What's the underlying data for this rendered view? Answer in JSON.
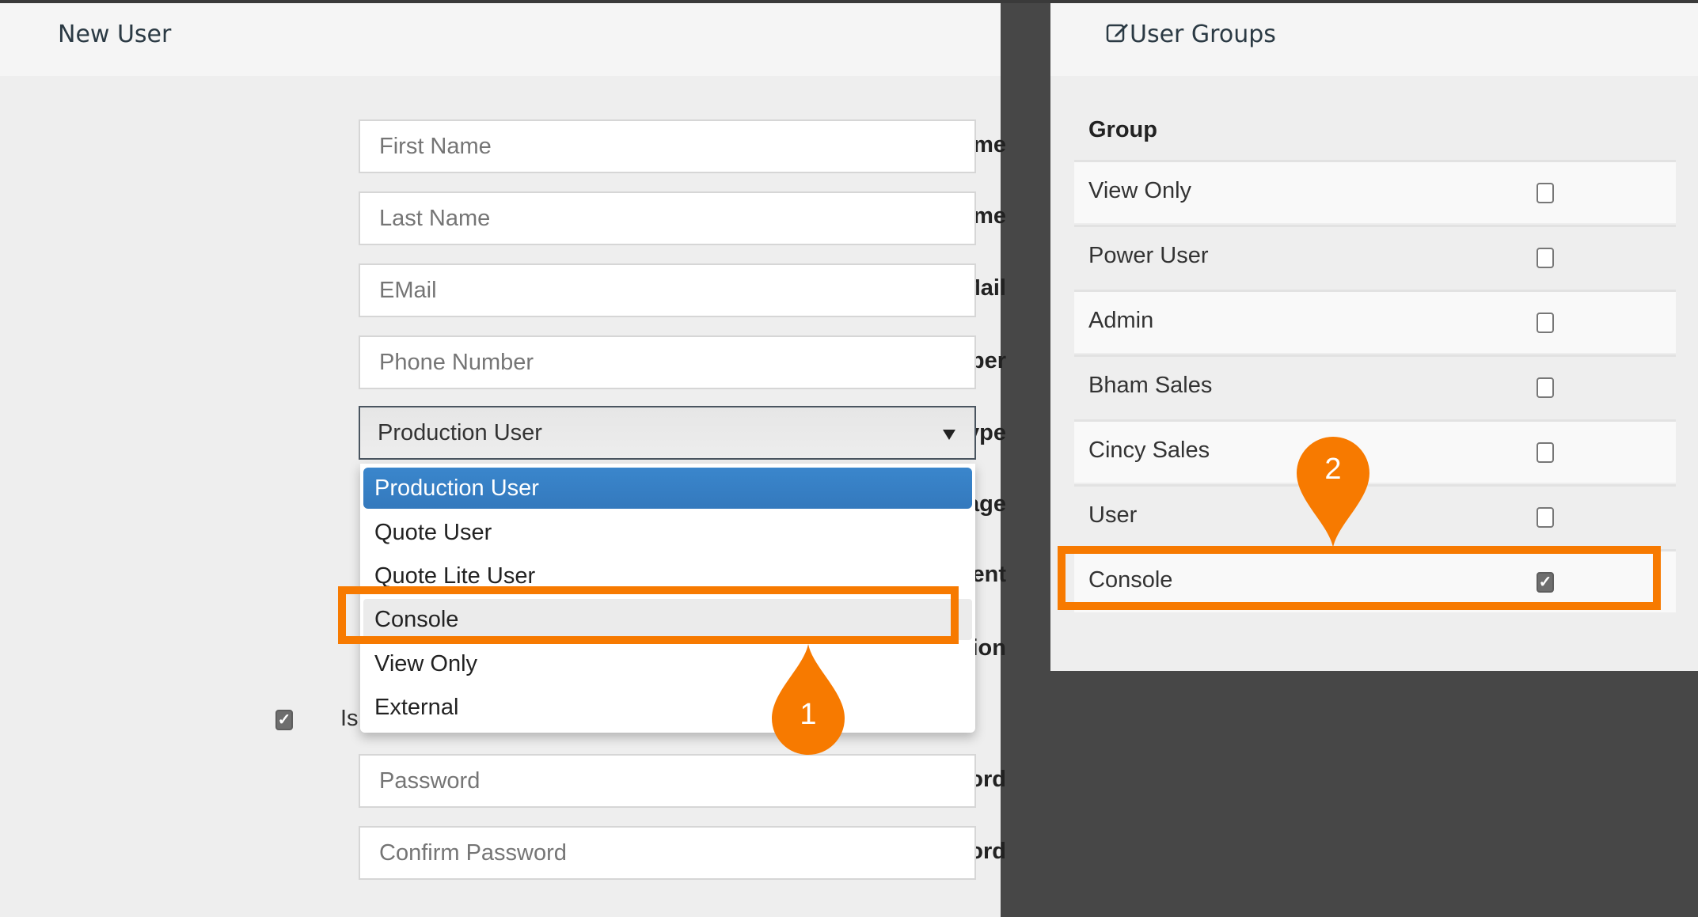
{
  "new_user_panel": {
    "title": "New User",
    "fields": [
      {
        "label": "First Name",
        "placeholder": "First Name"
      },
      {
        "label": "Last Name",
        "placeholder": "Last Name"
      },
      {
        "label": "E-Mail",
        "placeholder": "EMail"
      },
      {
        "label": "Phone Number",
        "placeholder": "Phone Number"
      },
      {
        "label": "Password",
        "placeholder": "Password"
      },
      {
        "label": "Confirm password",
        "placeholder": "Confirm Password"
      }
    ],
    "user_type": {
      "label": "UserType",
      "value": "Production User",
      "options": [
        "Production User",
        "Quote User",
        "Quote Lite User",
        "Console",
        "View Only",
        "External"
      ],
      "selected_option": "Production User",
      "hovered_option": "Console"
    },
    "hidden_labels": {
      "language": "Language",
      "department": "Department",
      "location": "Location"
    },
    "is_checkbox": {
      "label_partial": "Is",
      "checked": true
    }
  },
  "user_groups_panel": {
    "title": "User Groups",
    "title_icon": "edit-icon",
    "column_header": "Group",
    "groups": [
      {
        "name": "View Only",
        "checked": false
      },
      {
        "name": "Power User",
        "checked": false
      },
      {
        "name": "Admin",
        "checked": false
      },
      {
        "name": "Bham Sales",
        "checked": false
      },
      {
        "name": "Cincy Sales",
        "checked": false
      },
      {
        "name": "User",
        "checked": false
      },
      {
        "name": "Console",
        "checked": true
      }
    ]
  },
  "annotations": {
    "callout_1": "1",
    "callout_2": "2",
    "accent_color": "#f77a00"
  },
  "colors": {
    "selected_option_bg": "#3a86cc",
    "panel_bg": "#eeeeee",
    "backdrop": "#474747"
  }
}
